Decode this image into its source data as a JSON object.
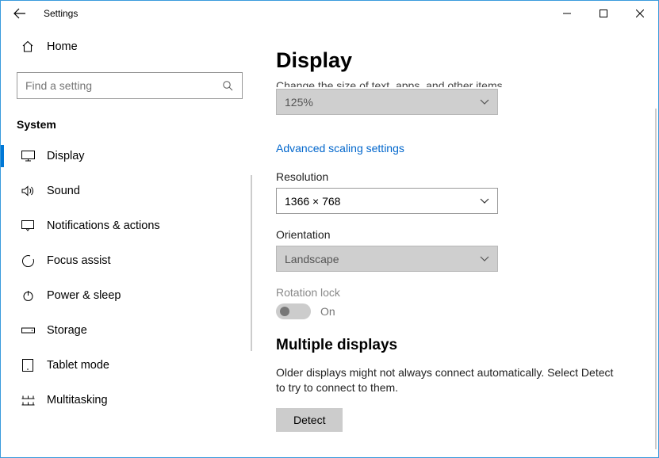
{
  "window": {
    "title": "Settings"
  },
  "sidebar": {
    "home_label": "Home",
    "search_placeholder": "Find a setting",
    "category_header": "System",
    "items": [
      {
        "label": "Display"
      },
      {
        "label": "Sound"
      },
      {
        "label": "Notifications & actions"
      },
      {
        "label": "Focus assist"
      },
      {
        "label": "Power & sleep"
      },
      {
        "label": "Storage"
      },
      {
        "label": "Tablet mode"
      },
      {
        "label": "Multitasking"
      }
    ]
  },
  "display": {
    "page_title": "Display",
    "truncated_line": "Change the size of text, apps, and other items",
    "scale_value": "125%",
    "advanced_link": "Advanced scaling settings",
    "resolution_label": "Resolution",
    "resolution_value": "1366 × 768",
    "orientation_label": "Orientation",
    "orientation_value": "Landscape",
    "rotation_lock_label": "Rotation lock",
    "rotation_lock_state": "On",
    "multiple_heading": "Multiple displays",
    "multiple_body": "Older displays might not always connect automatically. Select Detect to try to connect to them.",
    "detect_label": "Detect"
  }
}
